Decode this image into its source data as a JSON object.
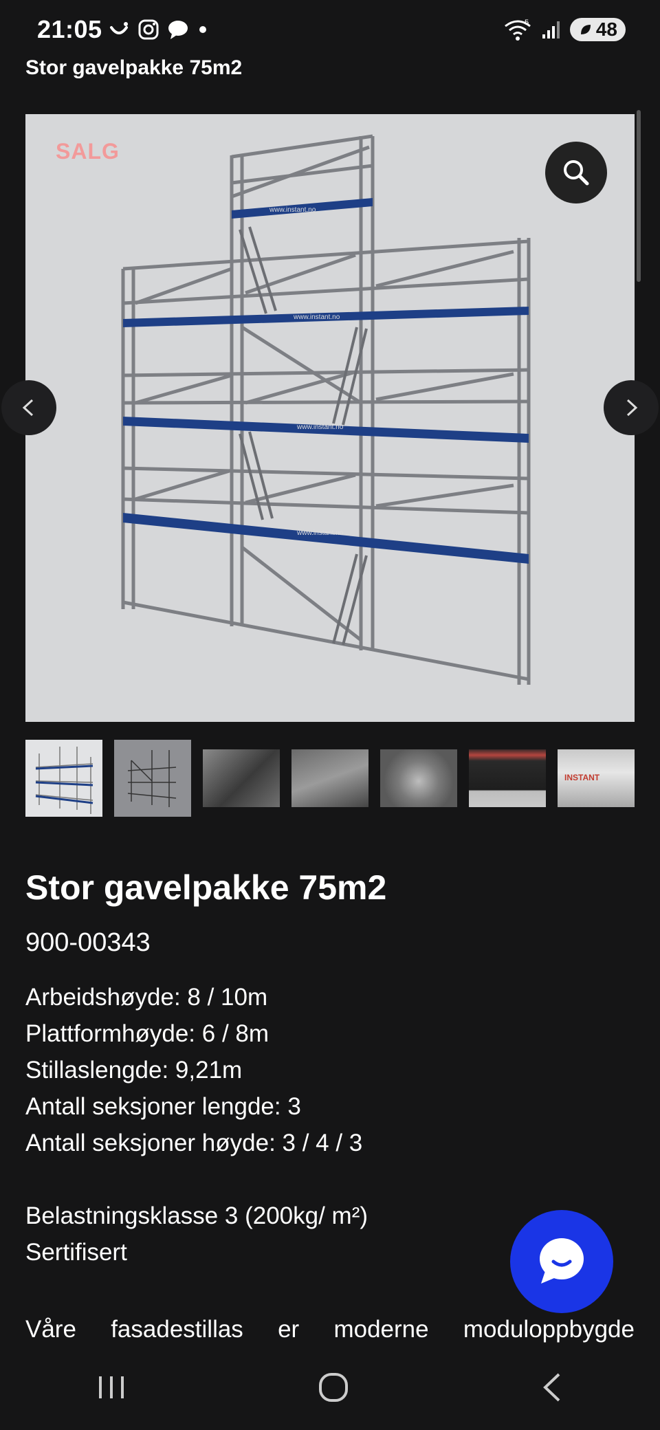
{
  "status": {
    "time": "21:05",
    "battery": "48",
    "network": "5"
  },
  "header": {
    "title": "Stor gavelpakke 75m2"
  },
  "gallery": {
    "badge": "SALG",
    "image_text": "www.instant.no",
    "thumb_text": "INSTANT"
  },
  "product": {
    "title": "Stor gavelpakke 75m2",
    "sku": "900-00343",
    "specs": [
      "Arbeidshøyde: 8 / 10m",
      "Plattformhøyde: 6 / 8m",
      "Stillaslengde: 9,21m",
      "Antall seksjoner lengde: 3",
      "Antall seksjoner høyde: 3 / 4 / 3"
    ],
    "load_class": "Belastningsklasse 3 (200kg/ m²)",
    "certified": "Sertifisert",
    "description_words": [
      "Våre",
      "fasadestillas",
      "er",
      "moderne",
      "moduloppbygde"
    ]
  },
  "icons": {
    "status_left": [
      "smile-icon",
      "instagram-icon",
      "chat-bubble-icon",
      "dot-icon"
    ],
    "status_right": [
      "wifi-icon",
      "signal-icon",
      "battery-icon"
    ],
    "gallery": [
      "zoom-icon",
      "chevron-left-icon",
      "chevron-right-icon"
    ],
    "fab": "chat-icon",
    "nav": [
      "recent-apps-icon",
      "home-icon",
      "back-icon"
    ]
  }
}
